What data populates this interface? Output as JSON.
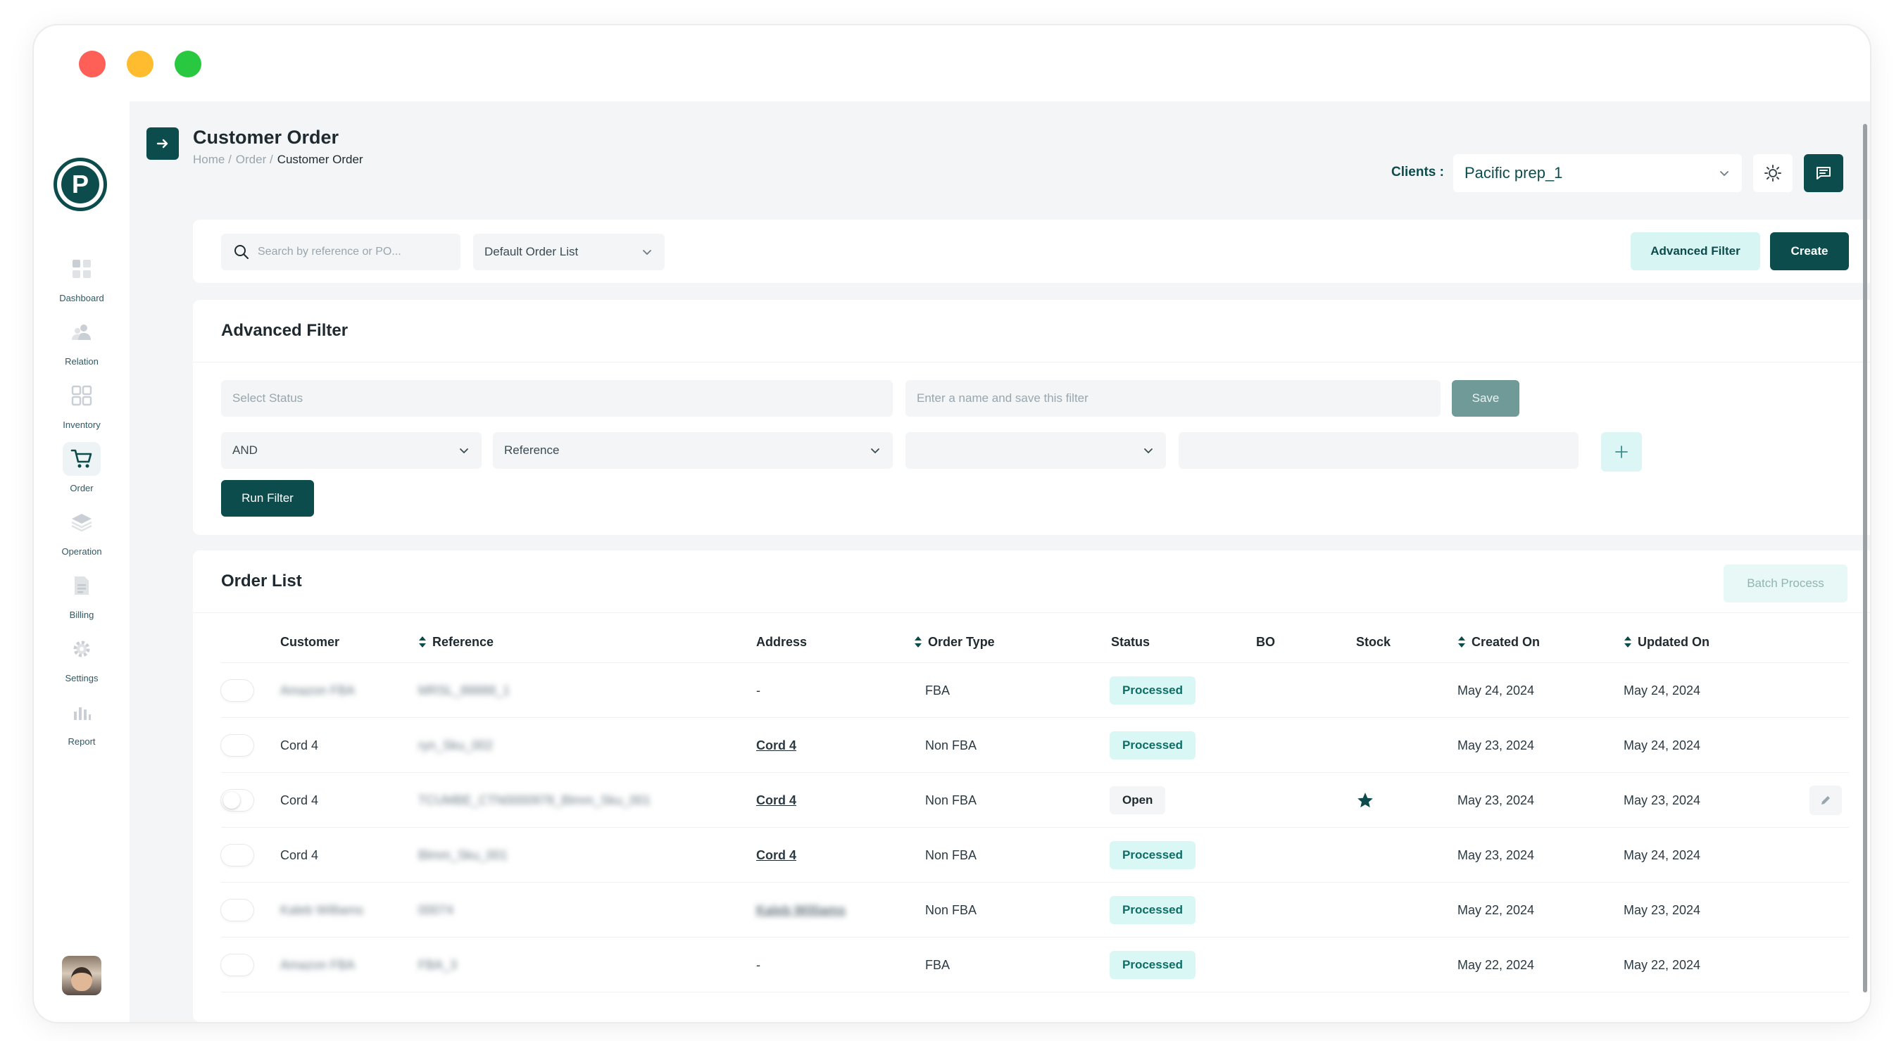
{
  "window": {
    "controls": [
      "close",
      "minimize",
      "maximize"
    ]
  },
  "brand": {
    "logo_letter": "P",
    "accent": "#0d4c4c"
  },
  "sidebar": {
    "items": [
      {
        "label": "Dashboard",
        "icon": "dashboard-icon"
      },
      {
        "label": "Relation",
        "icon": "relation-icon"
      },
      {
        "label": "Inventory",
        "icon": "inventory-icon"
      },
      {
        "label": "Order",
        "icon": "cart-icon",
        "active": true
      },
      {
        "label": "Operation",
        "icon": "layers-icon"
      },
      {
        "label": "Billing",
        "icon": "billing-icon"
      },
      {
        "label": "Settings",
        "icon": "gear-icon"
      },
      {
        "label": "Report",
        "icon": "bar-chart-icon"
      }
    ]
  },
  "header": {
    "title": "Customer Order",
    "breadcrumb": [
      "Home /",
      "Order /",
      "Customer Order"
    ],
    "clients_label": "Clients :",
    "client_selected": "Pacific prep_1"
  },
  "toolbar": {
    "search_placeholder": "Search by reference or PO...",
    "list_selected": "Default Order List",
    "advanced_filter_label": "Advanced Filter",
    "create_label": "Create"
  },
  "advanced_filter": {
    "title": "Advanced Filter",
    "status_placeholder": "Select Status",
    "name_placeholder": "Enter a name and save this filter",
    "save_label": "Save",
    "logic_selected": "AND",
    "field_selected": "Reference",
    "operator_selected": "",
    "value": "",
    "run_label": "Run Filter"
  },
  "order_list": {
    "title": "Order List",
    "batch_label": "Batch Process",
    "columns": [
      "Customer",
      "Reference",
      "Address",
      "Order Type",
      "Status",
      "BO",
      "Stock",
      "Created On",
      "Updated On"
    ],
    "rows": [
      {
        "customer": "Amazon FBA",
        "reference": "MRSL_88888_1",
        "address": "-",
        "address_bold": false,
        "order_type": "FBA",
        "status": "Processed",
        "stock_star": false,
        "created": "May 24, 2024",
        "updated": "May 24, 2024",
        "blur_customer": true,
        "blur_address": false
      },
      {
        "customer": "Cord 4",
        "reference": "ryn_Sku_002",
        "address": "Cord 4",
        "address_bold": true,
        "order_type": "Non FBA",
        "status": "Processed",
        "stock_star": false,
        "created": "May 23, 2024",
        "updated": "May 24, 2024",
        "blur_customer": false,
        "blur_address": false
      },
      {
        "customer": "Cord 4",
        "reference": "TCUMBE_CTN0000978_Blmm_Sku_001",
        "address": "Cord 4",
        "address_bold": true,
        "order_type": "Non FBA",
        "status": "Open",
        "stock_star": true,
        "created": "May 23, 2024",
        "updated": "May 23, 2024",
        "blur_customer": false,
        "blur_address": false,
        "editable": true
      },
      {
        "customer": "Cord 4",
        "reference": "Blmm_Sku_001",
        "address": "Cord 4",
        "address_bold": true,
        "order_type": "Non FBA",
        "status": "Processed",
        "stock_star": false,
        "created": "May 23, 2024",
        "updated": "May 24, 2024",
        "blur_customer": false,
        "blur_address": false
      },
      {
        "customer": "Kaleb Williams",
        "reference": "00074",
        "address": "Kaleb Williams",
        "address_bold": true,
        "order_type": "Non FBA",
        "status": "Processed",
        "stock_star": false,
        "created": "May 22, 2024",
        "updated": "May 23, 2024",
        "blur_customer": true,
        "blur_address": true
      },
      {
        "customer": "Amazon FBA",
        "reference": "FBA_3",
        "address": "-",
        "address_bold": false,
        "order_type": "FBA",
        "status": "Processed",
        "stock_star": false,
        "created": "May 22, 2024",
        "updated": "May 22, 2024",
        "blur_customer": true,
        "blur_address": false
      }
    ]
  }
}
